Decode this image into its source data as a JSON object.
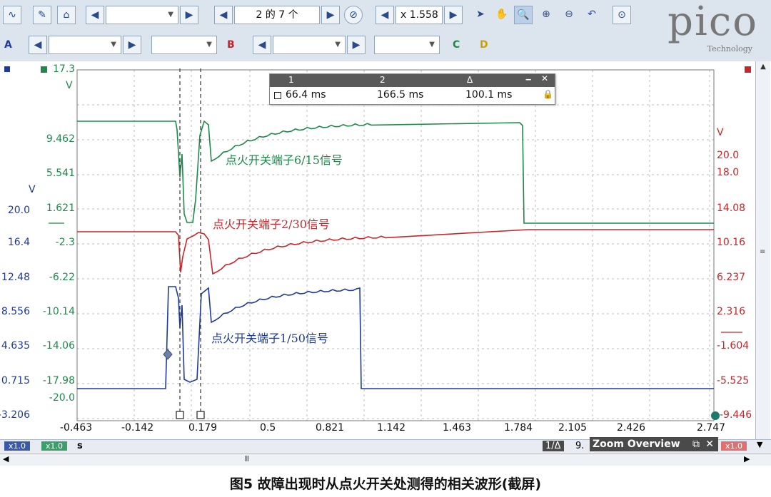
{
  "toolbar": {
    "page_indicator": "2 的 7 个",
    "zoom_level": "x 1.558",
    "channel_a_label": "A",
    "channel_b_label": "B",
    "channel_c_label": "C",
    "channel_d_label": "D"
  },
  "logo": {
    "brand": "pico",
    "sub": "Technology"
  },
  "axes": {
    "green_top": "17.3",
    "green_unit": "V",
    "green_ticks": [
      "9.462",
      "5.541",
      "1.621",
      "-2.3",
      "-6.22",
      "-10.14",
      "-14.06",
      "-17.98",
      "-20.0"
    ],
    "blue_unit": "V",
    "blue_ticks": [
      "20.0",
      "16.4",
      "12.48",
      "8.556",
      "4.635",
      "0.715",
      "-3.206"
    ],
    "red_unit": "V",
    "red_ticks": [
      "20.0",
      "18.0",
      "14.08",
      "10.16",
      "6.237",
      "2.316",
      "-1.604",
      "-5.525",
      "-9.446"
    ],
    "time_ticks": [
      "-0.463",
      "-0.142",
      "0.179",
      "0.5",
      "0.821",
      "1.142",
      "1.463",
      "1.784",
      "2.105",
      "2.426",
      "2.747"
    ],
    "time_unit": "s"
  },
  "measure": {
    "h1": "1",
    "h2": "2",
    "h3": "Δ",
    "v1": "66.4 ms",
    "v2": "166.5 ms",
    "v3": "100.1 ms"
  },
  "signals": {
    "green_label": "点火开关端子6/15信号",
    "red_label": "点火开关端子2/30信号",
    "blue_label": "点火开关端子1/50信号"
  },
  "colors": {
    "green": "#1e8a4a",
    "red": "#c8262a",
    "blue": "#1f3a9a",
    "grid": "#b9bcc0"
  },
  "status": {
    "x1_a": "x1.0",
    "x1_b": "x1.0",
    "s": "s",
    "ruler": "1/Δ",
    "nine": "9.",
    "zoom_overview": "Zoom Overview",
    "x1_c": "x1.0"
  },
  "caption": "图5   故障出现时从点火开关处测得的相关波形(截屏)"
}
